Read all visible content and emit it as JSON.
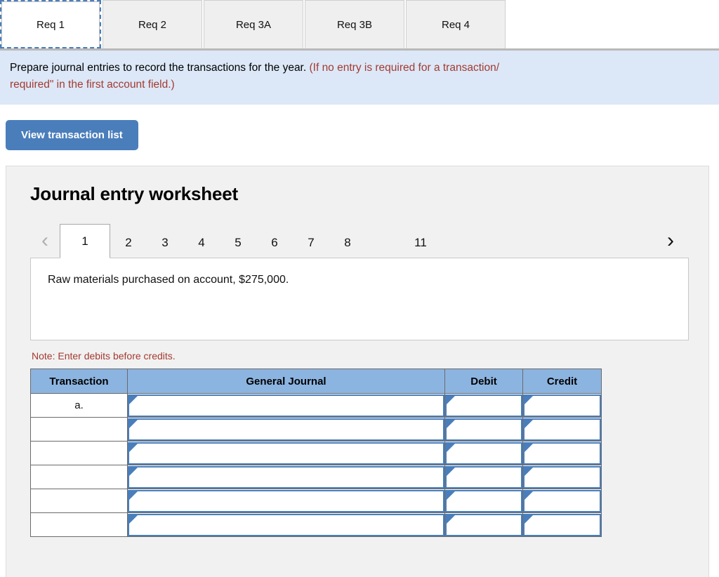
{
  "requirement_tabs": [
    {
      "label": "Req 1",
      "active": true
    },
    {
      "label": "Req 2",
      "active": false
    },
    {
      "label": "Req 3A",
      "active": false
    },
    {
      "label": "Req 3B",
      "active": false
    },
    {
      "label": "Req 4",
      "active": false
    }
  ],
  "instruction": {
    "main": "Prepare journal entries to record the transactions for the year.",
    "hint_line1": "(If no entry is required for a transaction/",
    "hint_line2": "required\" in the first account field.)"
  },
  "toolbar": {
    "view_transaction_list_label": "View transaction list"
  },
  "worksheet": {
    "title": "Journal entry worksheet",
    "pager": {
      "prev_icon": "chevron-left-icon",
      "next_icon": "chevron-right-icon",
      "pages": [
        {
          "label": "1",
          "active": true
        },
        {
          "label": "2",
          "active": false
        },
        {
          "label": "3",
          "active": false
        },
        {
          "label": "4",
          "active": false
        },
        {
          "label": "5",
          "active": false
        },
        {
          "label": "6",
          "active": false
        },
        {
          "label": "7",
          "active": false
        },
        {
          "label": "8",
          "active": false
        },
        {
          "label": "",
          "active": false
        },
        {
          "label": "11",
          "active": false
        }
      ]
    },
    "transaction_description": "Raw materials purchased on account, $275,000.",
    "note": "Note: Enter debits before credits.",
    "table": {
      "headers": [
        "Transaction",
        "General Journal",
        "Debit",
        "Credit"
      ],
      "rows": [
        {
          "transaction": "a.",
          "general_journal": "",
          "debit": "",
          "credit": ""
        },
        {
          "transaction": "",
          "general_journal": "",
          "debit": "",
          "credit": ""
        },
        {
          "transaction": "",
          "general_journal": "",
          "debit": "",
          "credit": ""
        },
        {
          "transaction": "",
          "general_journal": "",
          "debit": "",
          "credit": ""
        },
        {
          "transaction": "",
          "general_journal": "",
          "debit": "",
          "credit": ""
        },
        {
          "transaction": "",
          "general_journal": "",
          "debit": "",
          "credit": ""
        }
      ]
    }
  },
  "colors": {
    "accent_blue": "#4a7ebb",
    "table_header_blue": "#8cb4e0",
    "banner_blue": "#dce8f7",
    "note_red": "#a33a32",
    "panel_gray": "#f1f1f1"
  }
}
